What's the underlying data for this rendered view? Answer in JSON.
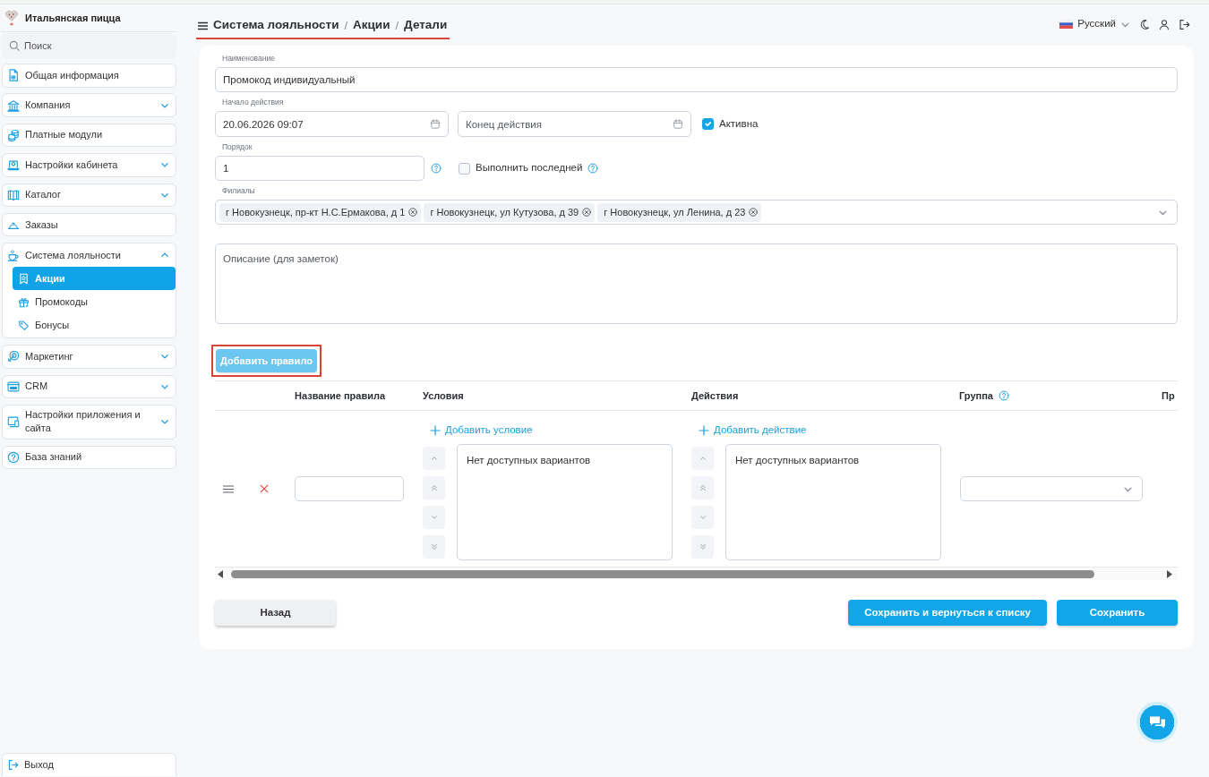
{
  "sidebar": {
    "brand": {
      "title": "Итальянская пицца"
    },
    "search": {
      "placeholder": "Поиск"
    },
    "items": [
      {
        "kind": "link",
        "label": "Общая информация",
        "selected": false
      },
      {
        "kind": "group",
        "label": "Компания",
        "expanded": false
      },
      {
        "kind": "link",
        "label": "Платные модули",
        "selected": false
      },
      {
        "kind": "group",
        "label": "Настройки кабинета",
        "expanded": false
      },
      {
        "kind": "group",
        "label": "Каталог",
        "expanded": false
      },
      {
        "kind": "link",
        "label": "Заказы",
        "selected": false
      },
      {
        "kind": "group",
        "label": "Система лояльности",
        "expanded": true,
        "children": [
          {
            "label": "Акции",
            "selected": true
          },
          {
            "label": "Промокоды",
            "selected": false
          },
          {
            "label": "Бонусы",
            "selected": false
          }
        ]
      },
      {
        "kind": "group",
        "label": "Маркетинг",
        "expanded": false
      },
      {
        "kind": "group",
        "label": "CRM",
        "expanded": false
      },
      {
        "kind": "group",
        "label": "Настройки приложения и сайта",
        "expanded": false
      },
      {
        "kind": "link",
        "label": "База знаний",
        "selected": false
      }
    ],
    "logout": {
      "label": "Выход"
    }
  },
  "header": {
    "breadcrumb": {
      "items": [
        "Система лояльности",
        "Акции",
        "Детали"
      ],
      "separator": "/",
      "highlighted": true
    },
    "language": "Русский"
  },
  "form": {
    "name": {
      "label": "Наименование",
      "value": "Промокод индивидуальный"
    },
    "period": {
      "label": "Начало действия",
      "start": {
        "value": "20.06.2026 09:07"
      },
      "end": {
        "placeholder": "Конец действия"
      }
    },
    "active": {
      "label": "Активна",
      "checked": true
    },
    "order": {
      "label": "Порядок",
      "value": "1",
      "help": true
    },
    "execute_last": {
      "label": "Выполнить последней",
      "checked": false,
      "help": true
    },
    "branches": {
      "label": "Филиалы",
      "chips": [
        "г Новокузнецк, пр-кт Н.С.Ермакова, д 1",
        "г Новокузнецк, ул Кутузова, д 39",
        "г Новокузнецк, ул Ленина, д 23"
      ]
    },
    "description": {
      "placeholder": "Описание (для заметок)"
    }
  },
  "rules": {
    "add_button": {
      "label": "Добавить правило",
      "highlighted": true
    },
    "columns": [
      {
        "label": "Название правила",
        "help": false
      },
      {
        "label": "Условия",
        "help": false
      },
      {
        "label": "Действия",
        "help": false
      },
      {
        "label": "Группа",
        "help": true
      },
      {
        "label": "Пр",
        "help": false
      }
    ],
    "rows": [
      {
        "conditions": {
          "add_label": "Добавить условие",
          "empty_text": "Нет доступных вариантов"
        },
        "actions": {
          "add_label": "Добавить действие",
          "empty_text": "Нет доступных вариантов"
        }
      }
    ]
  },
  "footer_buttons": [
    {
      "kind": "secondary",
      "label": "Назад"
    },
    {
      "kind": "primary",
      "label": "Сохранить и вернуться к списку"
    },
    {
      "kind": "primary",
      "label": "Сохранить"
    }
  ]
}
